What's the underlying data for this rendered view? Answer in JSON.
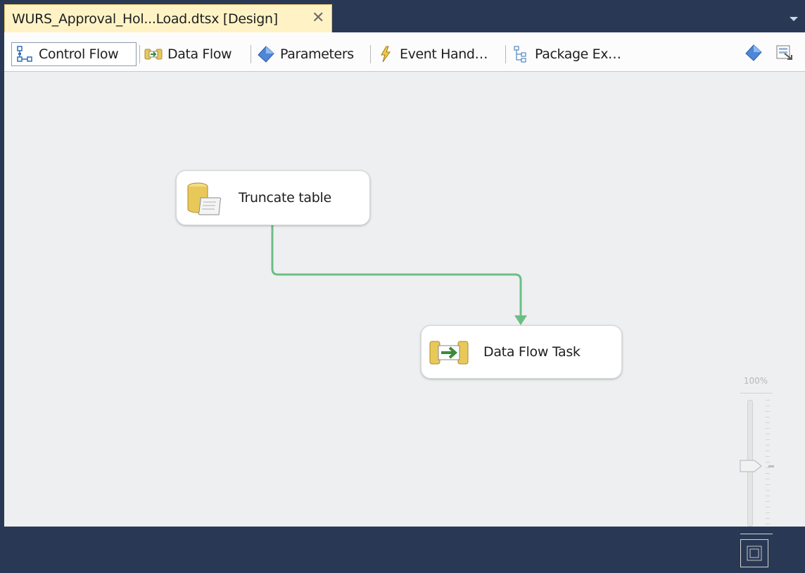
{
  "document_tab": {
    "title": "WURS_Approval_Hol...Load.dtsx [Design]",
    "close_glyph": "✕"
  },
  "designer_tabs": [
    {
      "label": "Control Flow",
      "icon": "control-flow-icon",
      "active": true
    },
    {
      "label": "Data Flow",
      "icon": "data-flow-icon",
      "active": false
    },
    {
      "label": "Parameters",
      "icon": "parameters-icon",
      "active": false
    },
    {
      "label": "Event Hand…",
      "icon": "event-handlers-icon",
      "active": false
    },
    {
      "label": "Package Ex…",
      "icon": "package-explorer-icon",
      "active": false
    }
  ],
  "toolbar_icons": [
    "variables-icon",
    "ssis-toolbox-icon"
  ],
  "canvas": {
    "tasks": [
      {
        "label": "Truncate table",
        "icon": "execute-sql-task-icon"
      },
      {
        "label": "Data Flow Task",
        "icon": "data-flow-task-icon"
      }
    ],
    "connector_color": "#6cbf84",
    "zoom": {
      "label": "100%",
      "level_percent": 100
    }
  },
  "colors": {
    "frame": "#293955",
    "tab_active": "#fff3c6",
    "canvas": "#eeeff1"
  }
}
